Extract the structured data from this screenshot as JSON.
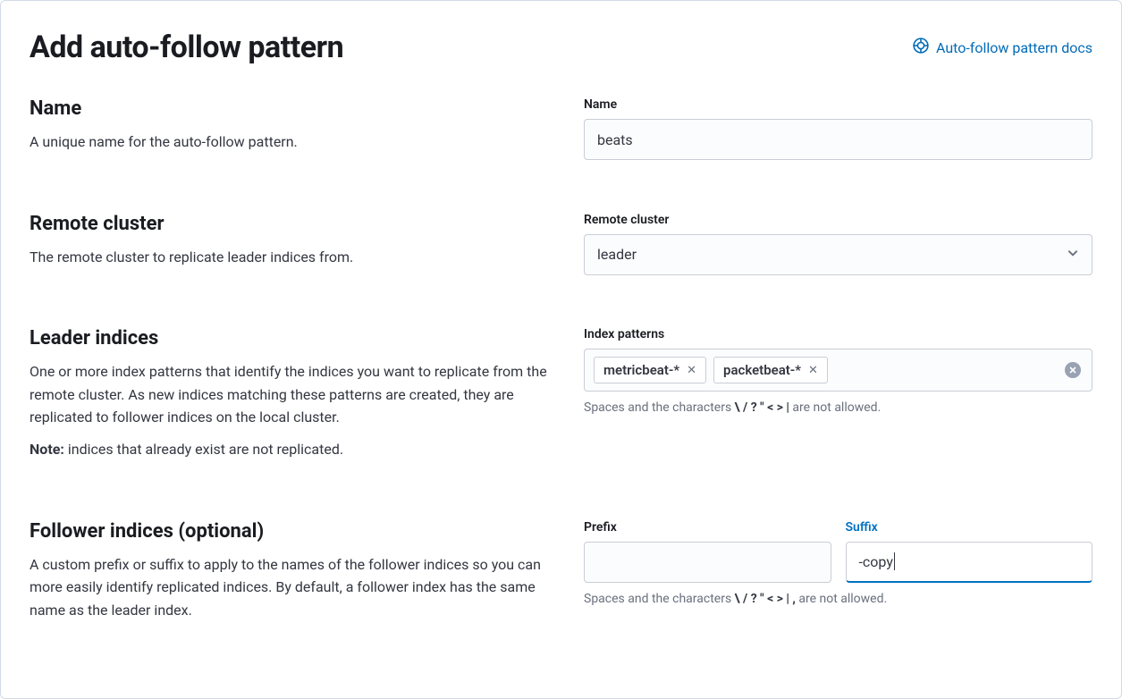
{
  "header": {
    "title": "Add auto-follow pattern",
    "docs_link": "Auto-follow pattern docs"
  },
  "sections": {
    "name": {
      "title": "Name",
      "desc": "A unique name for the auto-follow pattern.",
      "field_label": "Name",
      "value": "beats"
    },
    "remote": {
      "title": "Remote cluster",
      "desc": "The remote cluster to replicate leader indices from.",
      "field_label": "Remote cluster",
      "value": "leader"
    },
    "leader": {
      "title": "Leader indices",
      "desc": "One or more index patterns that identify the indices you want to replicate from the remote cluster. As new indices matching these patterns are created, they are replicated to follower indices on the local cluster.",
      "note_label": "Note:",
      "note_text": " indices that already exist are not replicated.",
      "field_label": "Index patterns",
      "patterns": [
        "metricbeat-*",
        "packetbeat-*"
      ],
      "help_prefix": "Spaces and the characters ",
      "help_chars": "\\ / ? \" < > |",
      "help_suffix": " are not allowed."
    },
    "follower": {
      "title": "Follower indices (optional)",
      "desc": "A custom prefix or suffix to apply to the names of the follower indices so you can more easily identify replicated indices. By default, a follower index has the same name as the leader index.",
      "prefix_label": "Prefix",
      "prefix_value": "",
      "suffix_label": "Suffix",
      "suffix_value": "-copy",
      "help_prefix": "Spaces and the characters ",
      "help_chars": "\\ / ? \" < > | ,",
      "help_suffix": " are not allowed."
    }
  }
}
